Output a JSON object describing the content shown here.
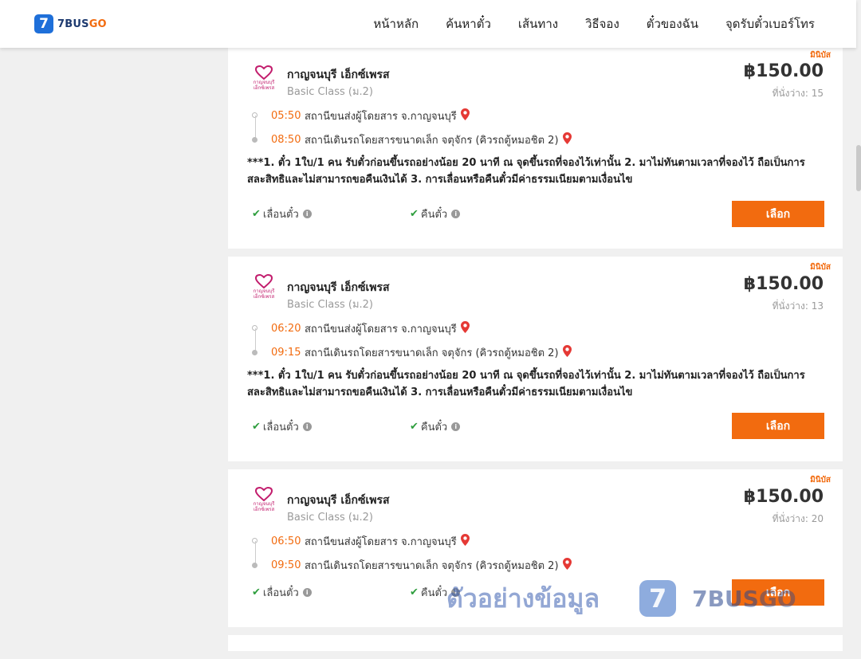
{
  "brand": {
    "logo_number": "7",
    "name_main": "7BUS",
    "name_go": "GO"
  },
  "nav": {
    "home": "หน้าหลัก",
    "search": "ค้นหาตั๋ว",
    "routes": "เส้นทาง",
    "how_to_book": "วิธีจอง",
    "my_tickets": "ตั๋วของฉัน",
    "phone_ticket": "จุดรับตั๋วเบอร์โทร"
  },
  "trips": [
    {
      "badge": "มินิบัส",
      "operator": "กาญจนบุรี เอ็กซ์เพรส",
      "operator_logo_text": [
        "กาญจนบุรี",
        "เอ็กซ์เพรส"
      ],
      "class": "Basic Class (ม.2)",
      "price": "฿150.00",
      "seats": "ที่นั่งว่าง: 15",
      "depart_time": "05:50",
      "depart_station": "สถานีขนส่งผู้โดยสาร จ.กาญจนบุรี",
      "arrive_time": "08:50",
      "arrive_station": "สถานีเดินรถโดยสารขนาดเล็ก จตุจักร (คิวรถตู้หมอชิต 2)",
      "notes": "***1. ตั๋ว 1ใบ/1 คน รับตั๋วก่อนขึ้นรถอย่างน้อย 20 นาที ณ จุดขึ้นรถที่จองไว้เท่านั้น 2. มาไม่ทันตามเวลาที่จองไว้ ถือเป็นการสละสิทธิและไม่สามารถขอคืนเงินได้ 3. การเลื่อนหรือคืนตั๋วมีค่าธรรมเนียมตามเงื่อนไข",
      "reschedule": "เลื่อนตั๋ว",
      "refund": "คืนตั๋ว",
      "select": "เลือก"
    },
    {
      "badge": "มินิบัส",
      "operator": "กาญจนบุรี เอ็กซ์เพรส",
      "operator_logo_text": [
        "กาญจนบุรี",
        "เอ็กซ์เพรส"
      ],
      "class": "Basic Class (ม.2)",
      "price": "฿150.00",
      "seats": "ที่นั่งว่าง: 13",
      "depart_time": "06:20",
      "depart_station": "สถานีขนส่งผู้โดยสาร จ.กาญจนบุรี",
      "arrive_time": "09:15",
      "arrive_station": "สถานีเดินรถโดยสารขนาดเล็ก จตุจักร (คิวรถตู้หมอชิต 2)",
      "notes": "***1. ตั๋ว 1ใบ/1 คน รับตั๋วก่อนขึ้นรถอย่างน้อย 20 นาที ณ จุดขึ้นรถที่จองไว้เท่านั้น 2. มาไม่ทันตามเวลาที่จองไว้ ถือเป็นการสละสิทธิและไม่สามารถขอคืนเงินได้ 3. การเลื่อนหรือคืนตั๋วมีค่าธรรมเนียมตามเงื่อนไข",
      "reschedule": "เลื่อนตั๋ว",
      "refund": "คืนตั๋ว",
      "select": "เลือก"
    },
    {
      "badge": "มินิบัส",
      "operator": "กาญจนบุรี เอ็กซ์เพรส",
      "operator_logo_text": [
        "กาญจนบุรี",
        "เอ็กซ์เพรส"
      ],
      "class": "Basic Class (ม.2)",
      "price": "฿150.00",
      "seats": "ที่นั่งว่าง: 20",
      "depart_time": "06:50",
      "depart_station": "สถานีขนส่งผู้โดยสาร จ.กาญจนบุรี",
      "arrive_time": "09:50",
      "arrive_station": "สถานีเดินรถโดยสารขนาดเล็ก จตุจักร (คิวรถตู้หมอชิต 2)",
      "reschedule": "เลื่อนตั๋ว",
      "refund": "คืนตั๋ว",
      "select": "เลือก"
    }
  ],
  "watermark": {
    "text": "ตัวอย่างข้อมูล",
    "logo_number": "7",
    "brand_main": "7BUS",
    "brand_go": "GO"
  },
  "icons": {
    "pin": "location-pin-icon",
    "check": "check-icon",
    "info": "info-icon"
  },
  "colors": {
    "accent": "#f26b0f",
    "brand_blue": "#1e6fd9",
    "pin_red": "#e53935",
    "check_green": "#2e9e3e"
  }
}
